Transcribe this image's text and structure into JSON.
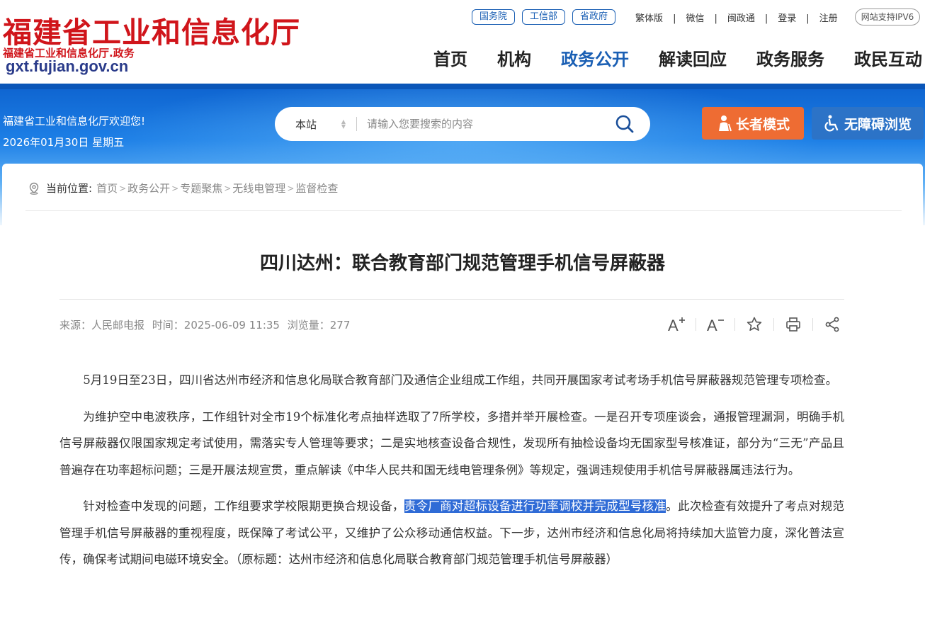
{
  "site": {
    "title": "福建省工业和信息化厅",
    "subtitle": "福建省工业和信息化厅.政务",
    "domain_bold": "gxt",
    "domain_rest": ".fujian.gov.cn"
  },
  "top_links": {
    "gov": [
      "国务院",
      "工信部",
      "省政府"
    ],
    "utils": [
      "繁体版",
      "微信",
      "闽政通",
      "登录",
      "注册"
    ],
    "ipv6": "网站支持IPV6"
  },
  "nav": {
    "items": [
      "首页",
      "机构",
      "政务公开",
      "解读回应",
      "政务服务",
      "政民互动"
    ],
    "active_index": 2
  },
  "banner": {
    "welcome": "福建省工业和信息化厅欢迎您!",
    "date": "2026年01月30日 星期五",
    "search_scope": "本站",
    "search_placeholder": "请输入您要搜索的内容",
    "elder_mode": "长者模式",
    "accessible": "无障碍浏览"
  },
  "breadcrumb": {
    "label": "当前位置:",
    "items": [
      "首页",
      "政务公开",
      "专题聚焦",
      "无线电管理",
      "监督检查"
    ]
  },
  "article": {
    "title": "四川达州：联合教育部门规范管理手机信号屏蔽器",
    "source": "来源：人民邮电报",
    "time": "时间：2025-06-09 11:35",
    "views": "浏览量：277",
    "p1": "5月19日至23日，四川省达州市经济和信息化局联合教育部门及通信企业组成工作组，共同开展国家考试考场手机信号屏蔽器规范管理专项检查。",
    "p2": "为维护空中电波秩序，工作组针对全市19个标准化考点抽样选取了7所学校，多措并举开展检查。一是召开专项座谈会，通报管理漏洞，明确手机信号屏蔽器仅限国家规定考试使用，需落实专人管理等要求；二是实地核查设备合规性，发现所有抽检设备均无国家型号核准证，部分为“三无”产品且普遍存在功率超标问题；三是开展法规宣贯，重点解读《中华人民共和国无线电管理条例》等规定，强调违规使用手机信号屏蔽器属违法行为。",
    "p3_pre": "针对检查中发现的问题，工作组要求学校限期更换合规设备，",
    "p3_highlight": "责令厂商对超标设备进行功率调校并完成型号核准",
    "p3_post": "。此次检查有效提升了考点对规范管理手机信号屏蔽器的重视程度，既保障了考试公平，又维护了公众移动通信权益。下一步，达州市经济和信息化局将持续加大监管力度，深化普法宣传，确保考试期间电磁环境安全。（原标题：达州市经济和信息化局联合教育部门规范管理手机信号屏蔽器）"
  },
  "colors": {
    "brand_red": "#d0151b",
    "nav_active": "#1a5fb4",
    "elder_orange": "#ee6c33",
    "access_blue": "#2c73c7",
    "highlight": "#2f6bd6"
  }
}
